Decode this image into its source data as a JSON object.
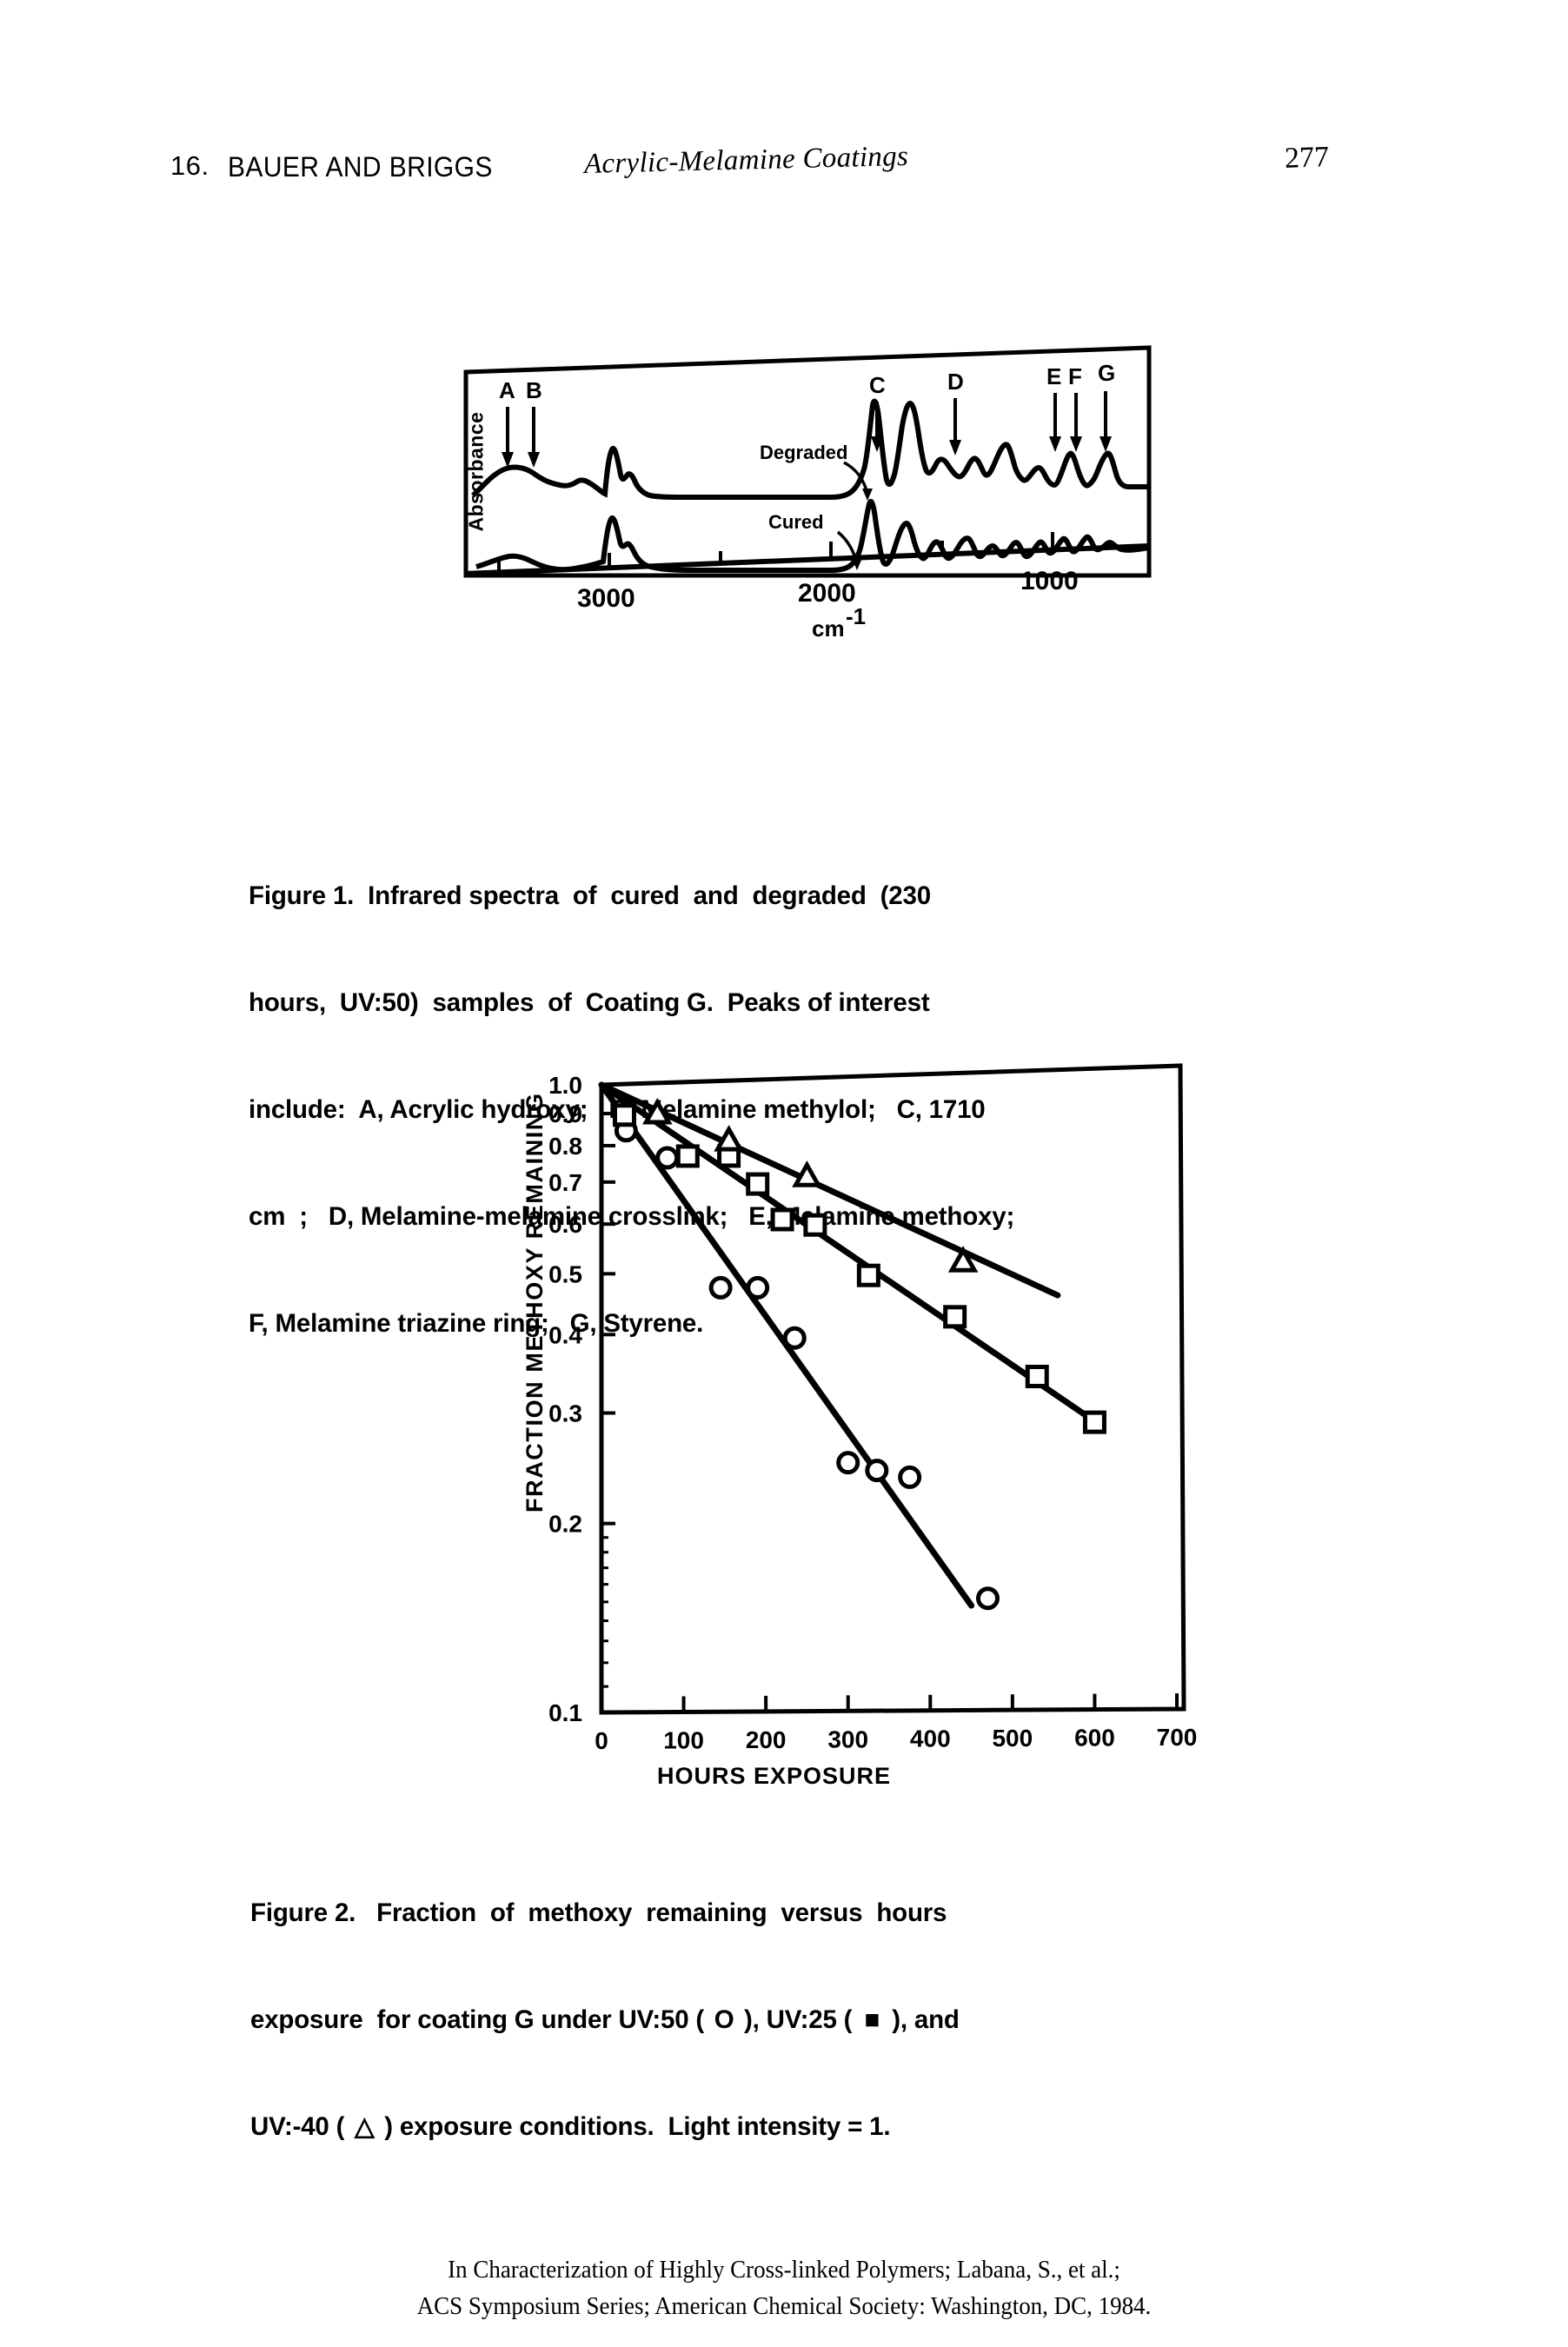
{
  "running_head": {
    "chapter_number": "16.",
    "authors": "BAUER AND BRIGGS",
    "book_title": "Acrylic-Melamine Coatings",
    "page_number": "277"
  },
  "figure1": {
    "y_axis_label": "Absorbance",
    "x_axis_label": "cm",
    "x_axis_exponent": "-1",
    "x_ticks": [
      "3000",
      "2000",
      "1000"
    ],
    "trace_labels": [
      "Degraded",
      "Cured"
    ],
    "peak_markers": [
      "A",
      "B",
      "C",
      "D",
      "E",
      "F",
      "G"
    ],
    "caption_lines": [
      "Figure 1.  Infrared spectra  of  cured  and  degraded  (230",
      "hours,  UV:50)  samples  of  Coating G.  Peaks of interest",
      "include:  A, Acrylic hydroxy;   B, Melamine methylol;   C, 1710",
      "cm  ;   D, Melamine-melamine crosslink;   E, Melamine methoxy;",
      "F, Melamine triazine ring;   G, Styrene."
    ],
    "caption_superscript": "-1"
  },
  "figure2": {
    "caption_part1": "Figure 2.   Fraction  of  methoxy  remaining  versus  hours",
    "caption_part2a": "exposure  for coating G under UV:50 ( ",
    "caption_sym1": "O",
    "caption_part2b": " ), UV:25 ( ",
    "caption_sym2": "■",
    "caption_part2c": " ), and",
    "caption_part3a": "UV:-40 ( ",
    "caption_sym3": "△",
    "caption_part3b": " ) exposure conditions.  Light intensity = 1."
  },
  "chart_data": {
    "type": "scatter",
    "title": "Fraction of methoxy remaining versus hours exposure",
    "xlabel": "HOURS  EXPOSURE",
    "ylabel": "FRACTION METHOXY REMAINING",
    "xlim": [
      0,
      700
    ],
    "ylim": [
      0.1,
      1.0
    ],
    "yscale": "log",
    "grid": false,
    "legend_position": "caption",
    "x_ticks": [
      "0",
      "100",
      "200",
      "300",
      "400",
      "500",
      "600",
      "700"
    ],
    "y_ticks": [
      "1.0",
      "0.9",
      "0.8",
      "0.7",
      "0.6",
      "0.5",
      "0.4",
      "0.3",
      "0.2",
      "0.1"
    ],
    "series": [
      {
        "name": "UV:50",
        "marker": "circle",
        "points": [
          {
            "x": 30,
            "y": 0.845
          },
          {
            "x": 80,
            "y": 0.765
          },
          {
            "x": 145,
            "y": 0.475
          },
          {
            "x": 190,
            "y": 0.475
          },
          {
            "x": 235,
            "y": 0.395
          },
          {
            "x": 300,
            "y": 0.25
          },
          {
            "x": 335,
            "y": 0.243
          },
          {
            "x": 375,
            "y": 0.237
          },
          {
            "x": 470,
            "y": 0.152
          }
        ],
        "fit_line": {
          "x0": 0,
          "y0": 1.0,
          "x1": 450,
          "y1": 0.148
        }
      },
      {
        "name": "UV:25",
        "marker": "square",
        "points": [
          {
            "x": 28,
            "y": 0.895
          },
          {
            "x": 105,
            "y": 0.77
          },
          {
            "x": 155,
            "y": 0.77
          },
          {
            "x": 190,
            "y": 0.695
          },
          {
            "x": 220,
            "y": 0.61
          },
          {
            "x": 260,
            "y": 0.598
          },
          {
            "x": 325,
            "y": 0.497
          },
          {
            "x": 430,
            "y": 0.427
          },
          {
            "x": 530,
            "y": 0.343
          },
          {
            "x": 600,
            "y": 0.29
          }
        ],
        "fit_line": {
          "x0": 0,
          "y0": 1.0,
          "x1": 605,
          "y1": 0.288
        }
      },
      {
        "name": "UV:-40",
        "marker": "triangle",
        "points": [
          {
            "x": 68,
            "y": 0.9
          },
          {
            "x": 155,
            "y": 0.815
          },
          {
            "x": 250,
            "y": 0.715
          },
          {
            "x": 440,
            "y": 0.523
          }
        ],
        "fit_line": {
          "x0": 0,
          "y0": 1.0,
          "x1": 555,
          "y1": 0.462
        }
      }
    ]
  },
  "footer": {
    "line1": "In Characterization of Highly Cross-linked Polymers; Labana, S., et al.;",
    "line2": "ACS Symposium Series; American Chemical Society: Washington, DC, 1984."
  }
}
